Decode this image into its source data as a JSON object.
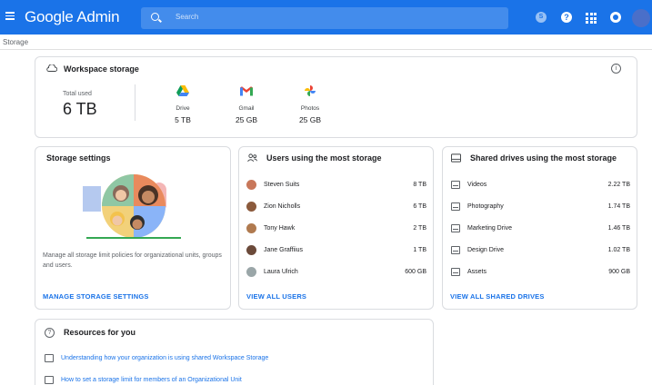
{
  "header": {
    "app_name": "Google Admin",
    "search_placeholder": "Search",
    "account_initial": "S",
    "help_glyph": "?"
  },
  "breadcrumb": "Storage",
  "workspace_storage": {
    "title": "Workspace storage",
    "total_label": "Total used",
    "total_value": "6 TB",
    "services": [
      {
        "name": "Drive",
        "value": "5 TB",
        "icon": "drive-icon"
      },
      {
        "name": "Gmail",
        "value": "25 GB",
        "icon": "gmail-icon"
      },
      {
        "name": "Photos",
        "value": "25 GB",
        "icon": "photos-icon"
      }
    ]
  },
  "storage_settings": {
    "title": "Storage settings",
    "description": "Manage all storage limit policies for organizational units, groups and users.",
    "link": "MANAGE STORAGE SETTINGS"
  },
  "users_storage": {
    "title": "Users using the most storage",
    "rows": [
      {
        "name": "Steven Suits",
        "value": "8 TB",
        "avatar_color": "#c8775a"
      },
      {
        "name": "Zion Nicholls",
        "value": "6 TB",
        "avatar_color": "#8b5a3c"
      },
      {
        "name": "Tony Hawk",
        "value": "2 TB",
        "avatar_color": "#b07a4f"
      },
      {
        "name": "Jane Graffiius",
        "value": "1 TB",
        "avatar_color": "#6b4a3a"
      },
      {
        "name": "Laura Ulrich",
        "value": "600 GB",
        "avatar_color": "#9aa6a8"
      }
    ],
    "link": "VIEW ALL USERS"
  },
  "shared_drives": {
    "title": "Shared drives using the most storage",
    "rows": [
      {
        "name": "Videos",
        "value": "2.22 TB"
      },
      {
        "name": "Photography",
        "value": "1.74 TB"
      },
      {
        "name": "Marketing Drive",
        "value": "1.46 TB"
      },
      {
        "name": "Design Drive",
        "value": "1.02 TB"
      },
      {
        "name": "Assets",
        "value": "900 GB"
      }
    ],
    "link": "VIEW ALL SHARED DRIVES"
  },
  "resources": {
    "title": "Resources for you",
    "links": [
      "Understanding how your organization is using shared Workspace Storage",
      "How to set a storage limit for members of an Organizational Unit"
    ]
  },
  "colors": {
    "header_bg": "#1a73e8",
    "link": "#1a73e8"
  }
}
